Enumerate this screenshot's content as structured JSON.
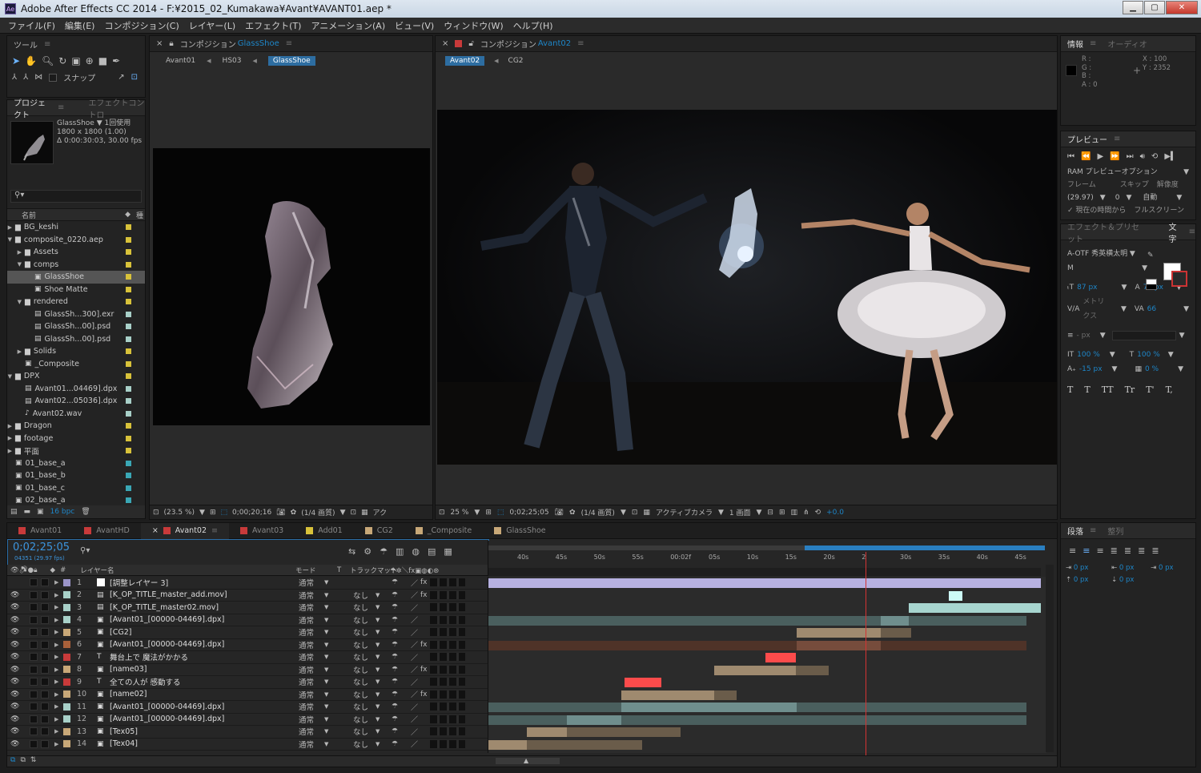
{
  "window": {
    "title": "Adobe After Effects CC 2014 - F:¥2015_02_Kumakawa¥Avant¥AVANT01.aep *",
    "app_badge": "Ae"
  },
  "menu": [
    "ファイル(F)",
    "編集(E)",
    "コンポジション(C)",
    "レイヤー(L)",
    "エフェクト(T)",
    "アニメーション(A)",
    "ビュー(V)",
    "ウィンドウ(W)",
    "ヘルプ(H)"
  ],
  "tools": {
    "tab": "ツール",
    "snap": "スナップ"
  },
  "project": {
    "tab": "プロジェクト",
    "tab2": "エフェクトコントロ",
    "item_name": "GlassShoe ▼",
    "usage": "1回使用",
    "size": "1800 x 1800 (1.00)",
    "duration": "Δ 0:00:30:03, 30.00 fps",
    "col_name": "名前",
    "col_type": "種",
    "bpc": "16 bpc",
    "items": [
      {
        "name": "BG_keshi",
        "indent": 0,
        "kind": "folder",
        "arrow": "▶",
        "label": "#d8c23a"
      },
      {
        "name": "composite_0220.aep",
        "indent": 0,
        "kind": "folder",
        "arrow": "▼",
        "label": "#d8c23a"
      },
      {
        "name": "Assets",
        "indent": 1,
        "kind": "folder",
        "arrow": "▶",
        "label": "#d8c23a"
      },
      {
        "name": "comps",
        "indent": 1,
        "kind": "folder",
        "arrow": "▼",
        "label": "#d8c23a"
      },
      {
        "name": "GlassShoe",
        "indent": 2,
        "kind": "comp",
        "arrow": "",
        "label": "#d8c23a",
        "selected": true
      },
      {
        "name": "Shoe Matte",
        "indent": 2,
        "kind": "comp",
        "arrow": "",
        "label": "#d8c23a"
      },
      {
        "name": "rendered",
        "indent": 1,
        "kind": "folder",
        "arrow": "▼",
        "label": "#d8c23a"
      },
      {
        "name": "GlassSh...300].exr",
        "indent": 2,
        "kind": "footage",
        "arrow": "",
        "label": "#a8d0c8"
      },
      {
        "name": "GlassSh...00].psd",
        "indent": 2,
        "kind": "footage",
        "arrow": "",
        "label": "#a8d0c8"
      },
      {
        "name": "GlassSh...00].psd",
        "indent": 2,
        "kind": "footage",
        "arrow": "",
        "label": "#a8d0c8"
      },
      {
        "name": "Solids",
        "indent": 1,
        "kind": "folder",
        "arrow": "▶",
        "label": "#d8c23a"
      },
      {
        "name": "_Composite",
        "indent": 1,
        "kind": "comp",
        "arrow": "",
        "label": "#d8c23a"
      },
      {
        "name": "DPX",
        "indent": 0,
        "kind": "folder",
        "arrow": "▼",
        "label": "#d8c23a"
      },
      {
        "name": "Avant01...04469].dpx",
        "indent": 1,
        "kind": "footage",
        "arrow": "",
        "label": "#a8d0c8"
      },
      {
        "name": "Avant02...05036].dpx",
        "indent": 1,
        "kind": "footage",
        "arrow": "",
        "label": "#a8d0c8"
      },
      {
        "name": "Avant02.wav",
        "indent": 1,
        "kind": "audio",
        "arrow": "",
        "label": "#a8d0c8"
      },
      {
        "name": "Dragon",
        "indent": 0,
        "kind": "folder",
        "arrow": "▶",
        "label": "#d8c23a"
      },
      {
        "name": "footage",
        "indent": 0,
        "kind": "folder",
        "arrow": "▶",
        "label": "#d8c23a"
      },
      {
        "name": "平面",
        "indent": 0,
        "kind": "folder",
        "arrow": "▶",
        "label": "#d8c23a"
      },
      {
        "name": "01_base_a",
        "indent": 0,
        "kind": "comp",
        "arrow": "",
        "label": "#3aa7b5"
      },
      {
        "name": "01_base_b",
        "indent": 0,
        "kind": "comp",
        "arrow": "",
        "label": "#3aa7b5"
      },
      {
        "name": "01_base_c",
        "indent": 0,
        "kind": "comp",
        "arrow": "",
        "label": "#3aa7b5"
      },
      {
        "name": "02_base_a",
        "indent": 0,
        "kind": "comp",
        "arrow": "",
        "label": "#3aa7b5"
      }
    ]
  },
  "comp1": {
    "tab_prefix": "コンポジション",
    "tab_name": "GlassShoe",
    "crumbs": [
      "Avant01",
      "HS03",
      "GlassShoe"
    ],
    "zoom": "(23.5 %)",
    "time": "0;00;20;16",
    "quality": "(1/4 画質)",
    "extra": "アク"
  },
  "comp2": {
    "tab_prefix": "コンポジション",
    "tab_name": "Avant02",
    "crumbs": [
      "Avant02",
      "CG2"
    ],
    "zoom": "25 %",
    "time": "0;02;25;05",
    "quality": "(1/4 画質)",
    "camera": "アクティブカメラ",
    "views": "1 画面",
    "exposure": "+0.0"
  },
  "info": {
    "tab": "情報",
    "tab2": "オーディオ",
    "r": "R :",
    "g": "G :",
    "b": "B :",
    "a": "A : 0",
    "x": "X : 100",
    "y": "Y : 2352"
  },
  "preview": {
    "tab": "プレビュー",
    "ram": "RAM プレビューオプション",
    "frame": "フレーム",
    "skip": "スキップ",
    "res": "解像度",
    "fps": "(29.97)",
    "skipval": "0",
    "resval": "自動",
    "from_now": "✓ 現在の時間から",
    "fullscreen": "フルスクリーン"
  },
  "character": {
    "tab": "エフェクト＆プリセット",
    "tab2": "文字",
    "font": "A-OTF 秀英横太明 ▼",
    "style": "M",
    "size": "87 px",
    "leading": "79 px",
    "kerning": "メトリクス",
    "tracking": "66",
    "stroke": "- px",
    "vscale": "100 %",
    "hscale": "100 %",
    "baseline": "-15 px",
    "tsume": "0 %",
    "styles": [
      "T",
      "T",
      "TT",
      "Tr",
      "T'",
      "T,"
    ]
  },
  "paragraph": {
    "tab": "段落",
    "tab2": "整列",
    "vals": [
      "0 px",
      "0 px",
      "0 px",
      "0 px",
      "0 px"
    ]
  },
  "timeline": {
    "tabs": [
      {
        "name": "Avant01",
        "color": "#c83a3a"
      },
      {
        "name": "AvantHD",
        "color": "#c83a3a"
      },
      {
        "name": "Avant02",
        "color": "#c83a3a",
        "active": true
      },
      {
        "name": "Avant03",
        "color": "#c83a3a"
      },
      {
        "name": "Add01",
        "color": "#d8c23a"
      },
      {
        "name": "CG2",
        "color": "#c8a878"
      },
      {
        "name": "_Composite",
        "color": "#c8a878"
      },
      {
        "name": "GlassShoe",
        "color": "#c8a878"
      }
    ],
    "timecode": "0;02;25;05",
    "frames": "04351 (29.97 fps)",
    "col_layer": "レイヤー名",
    "col_mode": "モード",
    "col_t": "T",
    "col_track": "トラックマット",
    "col_num": "#",
    "ruler": [
      "40s",
      "45s",
      "50s",
      "55s",
      "00:02f",
      "05s",
      "10s",
      "15s",
      "20s",
      "2",
      "30s",
      "35s",
      "40s",
      "45s"
    ],
    "layers": [
      {
        "n": "1",
        "name": "[調整レイヤー 3]",
        "color": "#9a94c8",
        "mode": "通常",
        "track": "",
        "fx": true,
        "type": "adj"
      },
      {
        "n": "2",
        "name": "[K_OP_TITLE_master_add.mov]",
        "color": "#a8d0c8",
        "mode": "通常",
        "track": "なし",
        "fx": true,
        "type": "mov"
      },
      {
        "n": "3",
        "name": "[K_OP_TITLE_master02.mov]",
        "color": "#a8d0c8",
        "mode": "通常",
        "track": "なし",
        "fx": false,
        "type": "mov"
      },
      {
        "n": "4",
        "name": "[Avant01_[00000-04469].dpx]",
        "color": "#a8d0c8",
        "mode": "通常",
        "track": "なし",
        "fx": false,
        "type": "dpx"
      },
      {
        "n": "5",
        "name": "[CG2]",
        "color": "#c8a878",
        "mode": "通常",
        "track": "なし",
        "fx": false,
        "type": "comp"
      },
      {
        "n": "6",
        "name": "[Avant01_[00000-04469].dpx]",
        "color": "#a8603a",
        "mode": "通常",
        "track": "なし",
        "fx": true,
        "type": "dpx"
      },
      {
        "n": "7",
        "name": "舞台上で 魔法がかかる",
        "color": "#c83a3a",
        "mode": "通常",
        "track": "なし",
        "fx": false,
        "type": "text"
      },
      {
        "n": "8",
        "name": "[name03]",
        "color": "#c8a878",
        "mode": "通常",
        "track": "なし",
        "fx": true,
        "type": "comp"
      },
      {
        "n": "9",
        "name": "全ての人が 感動する",
        "color": "#c83a3a",
        "mode": "通常",
        "track": "なし",
        "fx": false,
        "type": "text"
      },
      {
        "n": "10",
        "name": "[name02]",
        "color": "#c8a878",
        "mode": "通常",
        "track": "なし",
        "fx": true,
        "type": "comp"
      },
      {
        "n": "11",
        "name": "[Avant01_[00000-04469].dpx]",
        "color": "#a8d0c8",
        "mode": "通常",
        "track": "なし",
        "fx": false,
        "type": "dpx"
      },
      {
        "n": "12",
        "name": "[Avant01_[00000-04469].dpx]",
        "color": "#a8d0c8",
        "mode": "通常",
        "track": "なし",
        "fx": false,
        "type": "dpx"
      },
      {
        "n": "13",
        "name": "[Tex05]",
        "color": "#c8a878",
        "mode": "通常",
        "track": "なし",
        "fx": false,
        "type": "comp"
      },
      {
        "n": "14",
        "name": "[Tex04]",
        "color": "#c8a878",
        "mode": "通常",
        "track": "なし",
        "fx": false,
        "type": "comp"
      }
    ],
    "bars": [
      {
        "row": 0,
        "s": 0,
        "e": 690,
        "c": "#7a7696",
        "bright": [
          0,
          690
        ]
      },
      {
        "row": 1,
        "s": 575,
        "e": 592,
        "c": "#88a8a4",
        "bright": [
          575,
          592
        ]
      },
      {
        "row": 2,
        "s": 525,
        "e": 690,
        "c": "#6f8e8a",
        "bright": [
          525,
          690
        ]
      },
      {
        "row": 3,
        "s": 0,
        "e": 672,
        "c": "#4a5f5e",
        "bright": [
          490,
          525
        ]
      },
      {
        "row": 4,
        "s": 385,
        "e": 528,
        "c": "#6a5c4a",
        "bright": [
          385,
          490
        ]
      },
      {
        "row": 5,
        "s": 0,
        "e": 672,
        "c": "#4f3328",
        "bright": [
          385,
          490
        ]
      },
      {
        "row": 6,
        "s": 346,
        "e": 384,
        "c": "#a83232",
        "bright": [
          346,
          384
        ]
      },
      {
        "row": 7,
        "s": 282,
        "e": 425,
        "c": "#6a5c4a",
        "bright": [
          282,
          384
        ]
      },
      {
        "row": 8,
        "s": 170,
        "e": 216,
        "c": "#a83232",
        "bright": [
          170,
          216
        ]
      },
      {
        "row": 9,
        "s": 166,
        "e": 310,
        "c": "#6a5c4a",
        "bright": [
          166,
          282
        ]
      },
      {
        "row": 10,
        "s": 0,
        "e": 672,
        "c": "#4a5f5e",
        "bright": [
          166,
          385
        ]
      },
      {
        "row": 11,
        "s": 0,
        "e": 672,
        "c": "#4a5f5e",
        "bright": [
          98,
          166
        ]
      },
      {
        "row": 12,
        "s": 48,
        "e": 240,
        "c": "#6a5c4a",
        "bright": [
          48,
          98
        ]
      },
      {
        "row": 13,
        "s": 0,
        "e": 192,
        "c": "#6a5c4a",
        "bright": [
          0,
          48
        ]
      }
    ],
    "playhead": 472
  }
}
